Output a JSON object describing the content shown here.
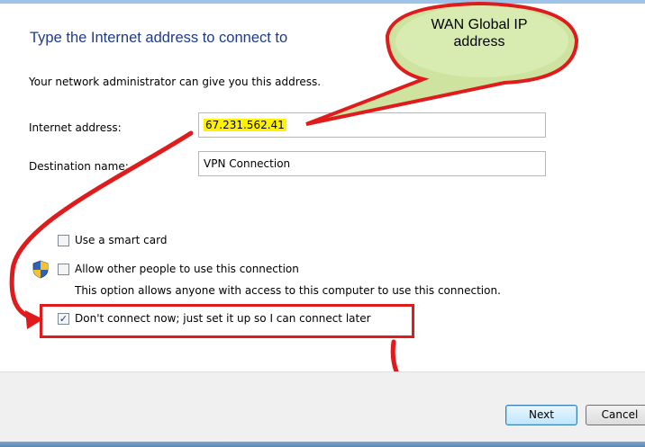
{
  "dialog": {
    "title": "Type the Internet address to connect to",
    "subtitle": "Your network administrator can give you this address.",
    "internet_address_label": "Internet address:",
    "internet_address_value": "67.231.562.41",
    "destination_name_label": "Destination name:",
    "destination_name_value": "VPN Connection",
    "smart_card_label": "Use a smart card",
    "smart_card_checked": false,
    "allow_others_label": "Allow other people to use this connection",
    "allow_others_checked": false,
    "allow_others_note": "This option allows anyone with access to this computer to use this connection.",
    "connect_later_label": "Don't connect now; just set it up so I can connect later",
    "connect_later_checked": true,
    "connect_later_mark": "✓",
    "shield_icon": "uac-shield-icon"
  },
  "buttons": {
    "next_label": "Next",
    "cancel_label": "Cancel"
  },
  "annotation": {
    "callout_line1": "WAN Global IP",
    "callout_line2": "address",
    "callout_color": "#cfe3a0",
    "arrow_color": "#e01b1b",
    "highlight_color": "#fff200"
  }
}
